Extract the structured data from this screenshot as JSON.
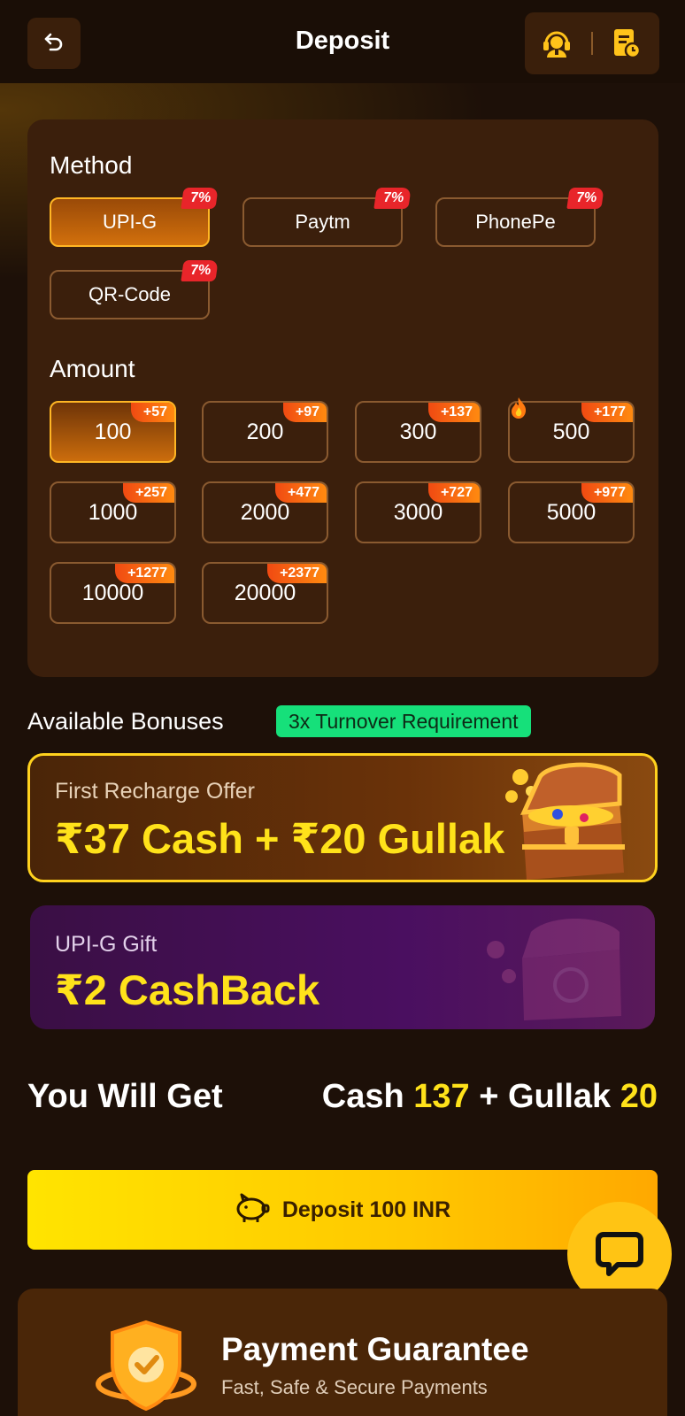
{
  "header": {
    "title": "Deposit",
    "back_icon": "back-arrow-icon",
    "support_icon": "customer-service-icon",
    "record_icon": "deposit-record-icon"
  },
  "method": {
    "label": "Method",
    "options": [
      {
        "label": "UPI-G",
        "badge": "7%",
        "selected": true
      },
      {
        "label": "Paytm",
        "badge": "7%",
        "selected": false
      },
      {
        "label": "PhonePe",
        "badge": "7%",
        "selected": false
      },
      {
        "label": "QR-Code",
        "badge": "7%",
        "selected": false
      }
    ]
  },
  "amount": {
    "label": "Amount",
    "options": [
      {
        "value": "100",
        "bonus": "+57",
        "selected": true
      },
      {
        "value": "200",
        "bonus": "+97"
      },
      {
        "value": "300",
        "bonus": "+137"
      },
      {
        "value": "500",
        "bonus": "+177",
        "hot": true
      },
      {
        "value": "1000",
        "bonus": "+257"
      },
      {
        "value": "2000",
        "bonus": "+477"
      },
      {
        "value": "3000",
        "bonus": "+727"
      },
      {
        "value": "5000",
        "bonus": "+977"
      },
      {
        "value": "10000",
        "bonus": "+1277"
      },
      {
        "value": "20000",
        "bonus": "+2377"
      }
    ]
  },
  "bonuses": {
    "title": "Available Bonuses",
    "turnover_tag": "3x Turnover Requirement",
    "first_offer": {
      "subtitle": "First Recharge Offer",
      "main": "₹37 Cash + ₹20 Gullak"
    },
    "gift": {
      "subtitle": "UPI-G Gift",
      "main": "₹2 CashBack"
    }
  },
  "summary": {
    "label": "You Will Get",
    "cash_label": "Cash",
    "cash_value": "137",
    "plus": "+",
    "gullak_label": "Gullak",
    "gullak_value": "20"
  },
  "deposit_button": {
    "label": "Deposit 100 INR"
  },
  "guarantee": {
    "title": "Payment Guarantee",
    "subtitle": "Fast, Safe & Secure Payments"
  },
  "colors": {
    "background": "#1d1008",
    "panel": "#3b1f0c",
    "accent_yellow": "#ffe21a",
    "active_border": "#ffb624",
    "badge_red": "#e8252a",
    "turnover_green": "#16e07a"
  }
}
